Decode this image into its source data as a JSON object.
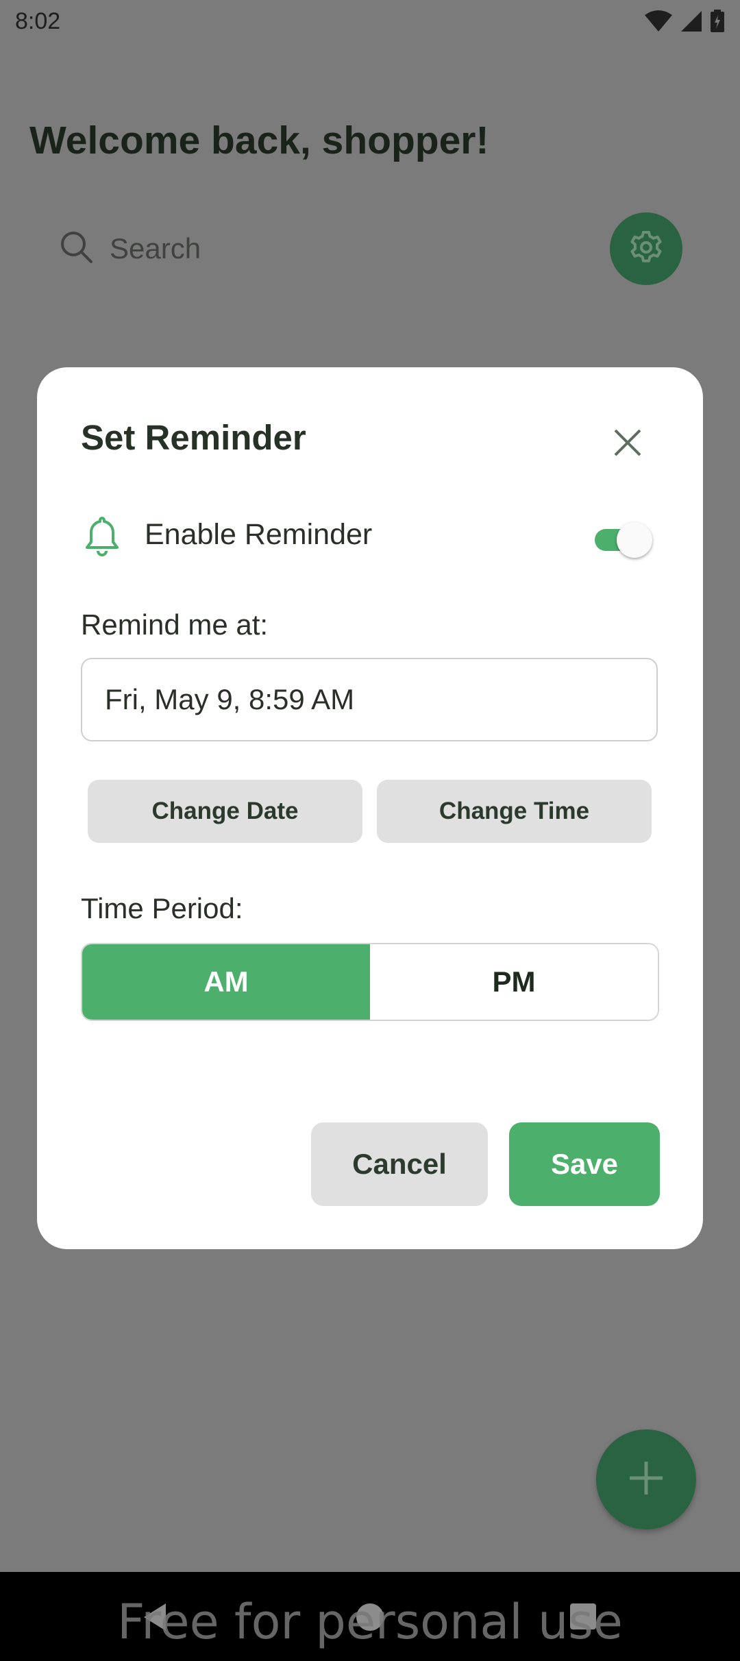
{
  "status_bar": {
    "time": "8:02",
    "icons": [
      "wifi-icon",
      "signal-icon",
      "battery-icon"
    ]
  },
  "background": {
    "welcome": "Welcome back, shopper!",
    "search_placeholder": "Search",
    "fab_icon": "plus-icon",
    "settings_icon": "gear-icon"
  },
  "dialog": {
    "title": "Set Reminder",
    "enable_label": "Enable Reminder",
    "enable_on": true,
    "remind_label": "Remind me at:",
    "datetime_value": "Fri, May 9, 8:59 AM",
    "change_date": "Change Date",
    "change_time": "Change Time",
    "period_label": "Time Period:",
    "period_am": "AM",
    "period_pm": "PM",
    "period_selected": "AM",
    "cancel": "Cancel",
    "save": "Save"
  },
  "watermark": "Free for personal use",
  "colors": {
    "accent": "#4caf6c",
    "dark_green": "#2a6341",
    "scrim": "#7b7b7b"
  }
}
